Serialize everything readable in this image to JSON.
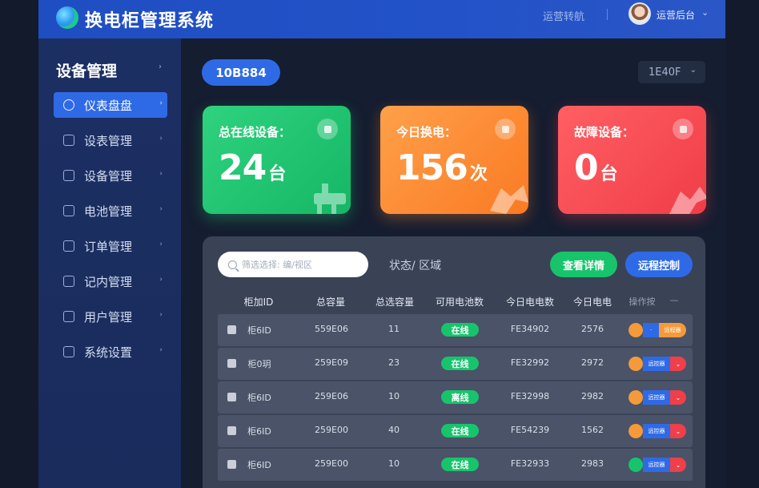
{
  "header": {
    "app_title": "换电柜管理系统",
    "link": "运营转航",
    "user": "运营后台",
    "caret": "⌄"
  },
  "sidebar": {
    "title": "设备管理",
    "items": [
      {
        "label": "仪表盘盘",
        "active": true
      },
      {
        "label": "设表管理"
      },
      {
        "label": "设备管理"
      },
      {
        "label": "电池管理"
      },
      {
        "label": "订单管理"
      },
      {
        "label": "记内管理"
      },
      {
        "label": "用户管理"
      },
      {
        "label": "系统设置"
      }
    ]
  },
  "main": {
    "device_id": "10B884",
    "select_value": "1E40F",
    "cards": [
      {
        "label": "总在线设备：",
        "value": "24",
        "unit": "台",
        "color": "#1fc472"
      },
      {
        "label": "今日换电：",
        "value": "156",
        "unit": "次",
        "color": "#fb8b33"
      },
      {
        "label": "故障设备：",
        "value": "0",
        "unit": "台",
        "color": "#f44a52"
      }
    ],
    "search_placeholder": "筛选选择: 编/视区",
    "filter_text": "状态/ 区域",
    "btn_detail": "查看详情",
    "btn_remote": "远程控制",
    "columns": [
      "柜加ID",
      "总容量",
      "总选容量",
      "可用电池数",
      "今日电电数",
      "今日电电",
      "操作按"
    ],
    "col_more": "—",
    "rows": [
      {
        "id": "柜6ID",
        "cap": "559E06",
        "sel": "11",
        "status": "在线",
        "today_count": "FE34902",
        "today": "2576",
        "op": "orange"
      },
      {
        "id": "柜0玥",
        "cap": "259E09",
        "sel": "23",
        "status": "在线",
        "today_count": "FE32992",
        "today": "2972",
        "op": "red"
      },
      {
        "id": "柜6ID",
        "cap": "259E06",
        "sel": "10",
        "status": "离线",
        "today_count": "FE32998",
        "today": "2982",
        "op": "red"
      },
      {
        "id": "柜6ID",
        "cap": "259E00",
        "sel": "40",
        "status": "在线",
        "today_count": "FE54239",
        "today": "1562",
        "op": "red"
      },
      {
        "id": "柜6ID",
        "cap": "259E00",
        "sel": "10",
        "status": "在线",
        "today_count": "FE32933",
        "today": "2983",
        "op": "red-green"
      }
    ],
    "op_labels": {
      "mid": "远控器",
      "orange_end": "远程器"
    }
  },
  "colors": {
    "accent": "#2f6ae6",
    "green": "#17c46c",
    "orange": "#f59a3a",
    "red": "#ee3f4a"
  }
}
